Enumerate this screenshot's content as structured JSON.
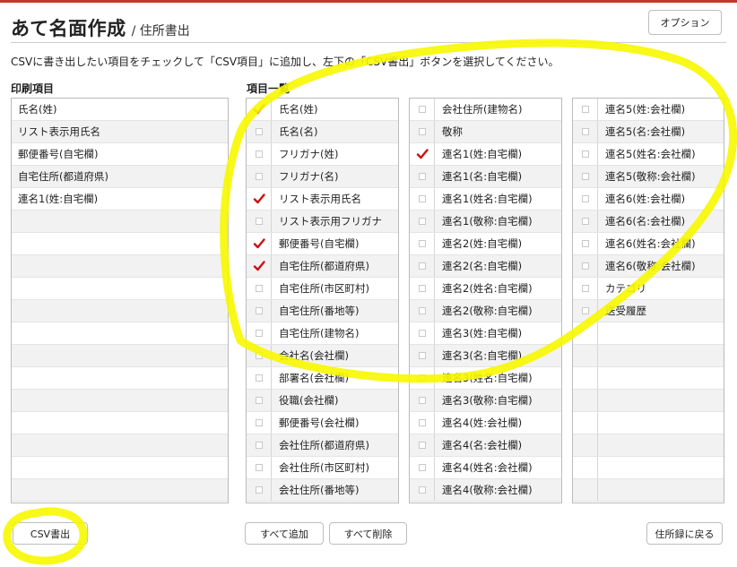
{
  "header": {
    "title": "あて名面作成",
    "breadcrumb": "/ 住所書出",
    "options_label": "オプション"
  },
  "instruction": "CSVに書き出したい項目をチェックして「CSV項目」に追加し、左下の「CSV書出」ボタンを選択してください。",
  "print_items": {
    "heading": "印刷項目",
    "items": [
      "氏名(姓)",
      "リスト表示用氏名",
      "郵便番号(自宅欄)",
      "自宅住所(都道府県)",
      "連名1(姓:自宅欄)"
    ]
  },
  "item_list": {
    "heading": "項目一覧",
    "columns": [
      [
        {
          "label": "氏名(姓)",
          "checked": true
        },
        {
          "label": "氏名(名)",
          "checked": false
        },
        {
          "label": "フリガナ(姓)",
          "checked": false
        },
        {
          "label": "フリガナ(名)",
          "checked": false
        },
        {
          "label": "リスト表示用氏名",
          "checked": true
        },
        {
          "label": "リスト表示用フリガナ",
          "checked": false
        },
        {
          "label": "郵便番号(自宅欄)",
          "checked": true
        },
        {
          "label": "自宅住所(都道府県)",
          "checked": true
        },
        {
          "label": "自宅住所(市区町村)",
          "checked": false
        },
        {
          "label": "自宅住所(番地等)",
          "checked": false
        },
        {
          "label": "自宅住所(建物名)",
          "checked": false
        },
        {
          "label": "会社名(会社欄)",
          "checked": false
        },
        {
          "label": "部署名(会社欄)",
          "checked": false
        },
        {
          "label": "役職(会社欄)",
          "checked": false
        },
        {
          "label": "郵便番号(会社欄)",
          "checked": false
        },
        {
          "label": "会社住所(都道府県)",
          "checked": false
        },
        {
          "label": "会社住所(市区町村)",
          "checked": false
        },
        {
          "label": "会社住所(番地等)",
          "checked": false
        }
      ],
      [
        {
          "label": "会社住所(建物名)",
          "checked": false
        },
        {
          "label": "敬称",
          "checked": false
        },
        {
          "label": "連名1(姓:自宅欄)",
          "checked": true
        },
        {
          "label": "連名1(名:自宅欄)",
          "checked": false
        },
        {
          "label": "連名1(姓名:自宅欄)",
          "checked": false
        },
        {
          "label": "連名1(敬称:自宅欄)",
          "checked": false
        },
        {
          "label": "連名2(姓:自宅欄)",
          "checked": false
        },
        {
          "label": "連名2(名:自宅欄)",
          "checked": false
        },
        {
          "label": "連名2(姓名:自宅欄)",
          "checked": false
        },
        {
          "label": "連名2(敬称:自宅欄)",
          "checked": false
        },
        {
          "label": "連名3(姓:自宅欄)",
          "checked": false
        },
        {
          "label": "連名3(名:自宅欄)",
          "checked": false
        },
        {
          "label": "連名3(姓名:自宅欄)",
          "checked": false
        },
        {
          "label": "連名3(敬称:自宅欄)",
          "checked": false
        },
        {
          "label": "連名4(姓:会社欄)",
          "checked": false
        },
        {
          "label": "連名4(名:会社欄)",
          "checked": false
        },
        {
          "label": "連名4(姓名:会社欄)",
          "checked": false
        },
        {
          "label": "連名4(敬称:会社欄)",
          "checked": false
        }
      ],
      [
        {
          "label": "連名5(姓:会社欄)",
          "checked": false
        },
        {
          "label": "連名5(名:会社欄)",
          "checked": false
        },
        {
          "label": "連名5(姓名:会社欄)",
          "checked": false
        },
        {
          "label": "連名5(敬称:会社欄)",
          "checked": false
        },
        {
          "label": "連名6(姓:会社欄)",
          "checked": false
        },
        {
          "label": "連名6(名:会社欄)",
          "checked": false
        },
        {
          "label": "連名6(姓名:会社欄)",
          "checked": false
        },
        {
          "label": "連名6(敬称:会社欄)",
          "checked": false
        },
        {
          "label": "カテゴリ",
          "checked": false
        },
        {
          "label": "送受履歴",
          "checked": false
        }
      ]
    ]
  },
  "buttons": {
    "csv_export": "CSV書出",
    "add_all": "すべて追加",
    "remove_all": "すべて削除",
    "back_to_address_book": "住所録に戻る"
  },
  "colors": {
    "accent_bar": "#c0392b",
    "check_mark": "#cc1111",
    "highlight": "#f7f700"
  }
}
